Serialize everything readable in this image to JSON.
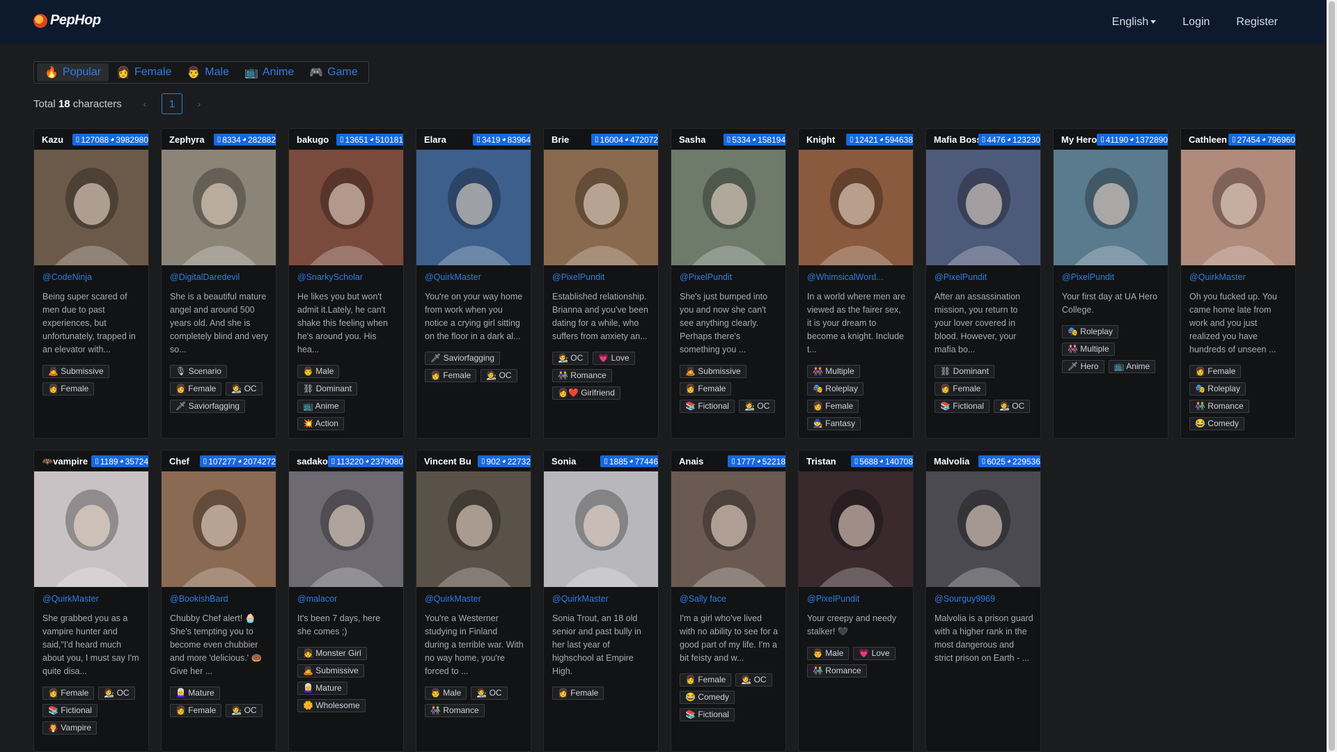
{
  "header": {
    "logo_text": "PepHop",
    "language": "English",
    "login": "Login",
    "register": "Register"
  },
  "tabs": [
    {
      "icon": "🔥",
      "label": "Popular",
      "active": true
    },
    {
      "icon": "👩",
      "label": "Female",
      "active": false
    },
    {
      "icon": "👨",
      "label": "Male",
      "active": false
    },
    {
      "icon": "📺",
      "label": "Anime",
      "active": false
    },
    {
      "icon": "🎮",
      "label": "Game",
      "active": false
    }
  ],
  "summary": {
    "total_prefix": "Total",
    "total_count": "18",
    "total_suffix": "characters",
    "current_page": "1",
    "prev": "‹",
    "next": "›"
  },
  "cards": [
    {
      "name": "Kazu",
      "chats": "127088",
      "likes": "3982980",
      "author": "@CodeNinja",
      "desc": "Being super scared of men due to past experiences, but unfortunately, trapped in an elevator with...",
      "tags": [
        "🙇 Submissive",
        "👩 Female"
      ],
      "img_color": "#6b5a4a"
    },
    {
      "name": "Zephyra",
      "chats": "8334",
      "likes": "282882",
      "author": "@DigitalDaredevil",
      "desc": "She is a beautiful mature angel and around 500 years old. And she is completely blind and very so...",
      "tags": [
        "🎙 Scenario",
        "👩 Female",
        "🧑‍🎨 OC",
        "🗡 Saviorfagging"
      ],
      "img_color": "#8c8477"
    },
    {
      "name": "bakugo",
      "chats": "13651",
      "likes": "510181",
      "author": "@SnarkyScholar",
      "desc": "He likes you but won't admit it.Lately, he can't shake this feeling when he's around you. His hea...",
      "tags": [
        "👨 Male",
        "⛓ Dominant",
        "📺 Anime",
        "💥 Action"
      ],
      "img_color": "#7a4a3c"
    },
    {
      "name": "Elara",
      "chats": "3419",
      "likes": "83964",
      "author": "@QuirkMaster",
      "desc": "You're on your way home from work when you notice a crying girl sitting on the floor in a dark al...",
      "tags": [
        "🗡 Saviorfagging",
        "👩 Female",
        "🧑‍🎨 OC"
      ],
      "img_color": "#3d5f8c"
    },
    {
      "name": "Brie",
      "chats": "16004",
      "likes": "472072",
      "author": "@PixelPundit",
      "desc": "Established relationship. Brianna and you've been dating for a while, who suffers from anxiety an...",
      "tags": [
        "🧑‍🎨 OC",
        "💗 Love",
        "👫 Romance",
        "👩‍❤️ Girlfriend"
      ],
      "img_color": "#8a6a4e"
    },
    {
      "name": "Sasha",
      "chats": "5334",
      "likes": "158194",
      "author": "@PixelPundit",
      "desc": "She's just bumped into you and now she can't see anything clearly. Perhaps there's something you ...",
      "tags": [
        "🙇 Submissive",
        "👩 Female",
        "📚 Fictional",
        "🧑‍🎨 OC"
      ],
      "img_color": "#6e7a6a"
    },
    {
      "name": "Knight",
      "chats": "12421",
      "likes": "594638",
      "author": "@WhimsicalWord...",
      "desc": "In a world where men are viewed as the fairer sex, it is your dream to become a knight. Include t...",
      "tags": [
        "👭 Multiple",
        "🎭 Roleplay",
        "👩 Female",
        "🧙 Fantasy"
      ],
      "img_color": "#8a5a3e"
    },
    {
      "name": "Mafia Boss",
      "chats": "4476",
      "likes": "123230",
      "author": "@PixelPundit",
      "desc": "After an assassination mission, you return to your lover covered in blood. However, your mafia bo...",
      "tags": [
        "⛓ Dominant",
        "👩 Female",
        "📚 Fictional",
        "🧑‍🎨 OC"
      ],
      "img_color": "#4e5a7a"
    },
    {
      "name": "My Hero",
      "chats": "41190",
      "likes": "1372890",
      "author": "@PixelPundit",
      "desc": "Your first day at UA Hero College.",
      "tags": [
        "🎭 Roleplay",
        "👭 Multiple",
        "🗡 Hero",
        "📺 Anime"
      ],
      "img_color": "#5a7a8e"
    },
    {
      "name": "Cathleen",
      "chats": "27454",
      "likes": "796960",
      "author": "@QuirkMaster",
      "desc": "Oh you fucked up. You came home late from work and you just realized you have hundreds of unseen ...",
      "tags": [
        "👩 Female",
        "🎭 Roleplay",
        "👫 Romance",
        "😂 Comedy"
      ],
      "img_color": "#b08a7a"
    },
    {
      "name": "🦇vampire",
      "chats": "1189",
      "likes": "35724",
      "author": "@QuirkMaster",
      "desc": "She grabbed you as a vampire hunter and said,\"I'd heard much about you, I must say I'm quite disa...",
      "tags": [
        "👩 Female",
        "🧑‍🎨 OC",
        "📚 Fictional",
        "🧛 Vampire"
      ],
      "img_color": "#c8c2c4"
    },
    {
      "name": "Chef",
      "chats": "107277",
      "likes": "2074272",
      "author": "@BookishBard",
      "desc": "Chubby Chef alert! 🧁 She's tempting you to become even chubbier and more 'delicious.' 🍩 Give her ...",
      "tags": [
        "👩‍🦳 Mature",
        "👩 Female",
        "🧑‍🎨 OC"
      ],
      "img_color": "#8a6a52"
    },
    {
      "name": "sadako",
      "chats": "113220",
      "likes": "2379080",
      "author": "@malacor",
      "desc": "It's been 7 days, here she comes ;)",
      "tags": [
        "👧 Monster Girl",
        "🙇 Submissive",
        "👩‍🦳 Mature",
        "🌼 Wholesome"
      ],
      "img_color": "#6e6a72"
    },
    {
      "name": "Vincent Bu",
      "chats": "902",
      "likes": "22732",
      "author": "@QuirkMaster",
      "desc": "You're a Westerner studying in Finland during a terrible war. With no way home, you're forced to ...",
      "tags": [
        "👨 Male",
        "🧑‍🎨 OC",
        "👫 Romance"
      ],
      "img_color": "#5a5248"
    },
    {
      "name": "Sonia",
      "chats": "1885",
      "likes": "77446",
      "author": "@QuirkMaster",
      "desc": "Sonia Trout, an 18 old senior and past bully in her last year of highschool at Empire High.",
      "tags": [
        "👩 Female"
      ],
      "img_color": "#b8b8bc"
    },
    {
      "name": "Anais",
      "chats": "1777",
      "likes": "52218",
      "author": "@Sally face",
      "desc": "I'm a girl who've lived with no ability to see for a good part of my life. I'm a bit feisty and w...",
      "tags": [
        "👩 Female",
        "🧑‍🎨 OC",
        "😂 Comedy",
        "📚 Fictional"
      ],
      "img_color": "#6a5a52"
    },
    {
      "name": "Tristan",
      "chats": "5688",
      "likes": "140708",
      "author": "@PixelPundit",
      "desc": "Your creepy and needy stalker! 🖤",
      "tags": [
        "👨 Male",
        "💗 Love",
        "👫 Romance"
      ],
      "img_color": "#3a2a2e"
    },
    {
      "name": "Malvolia",
      "chats": "6025",
      "likes": "229536",
      "author": "@Sourguy9969",
      "desc": "Malvolia is a prison guard with a higher rank in the most dangerous and strict prison on Earth - ...",
      "tags": [],
      "img_color": "#4a4a50"
    }
  ]
}
